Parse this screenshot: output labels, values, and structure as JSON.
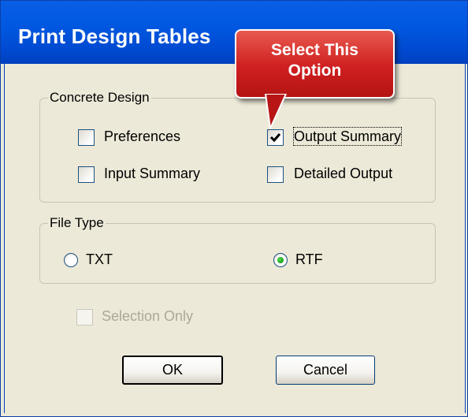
{
  "window": {
    "title": "Print  Design Tables"
  },
  "callout": {
    "line1": "Select This",
    "line2": "Option"
  },
  "concrete_design": {
    "label": "Concrete Design",
    "options": [
      {
        "label": "Preferences",
        "checked": false
      },
      {
        "label": "Output Summary",
        "checked": true
      },
      {
        "label": "Input Summary",
        "checked": false
      },
      {
        "label": "Detailed Output",
        "checked": false
      }
    ]
  },
  "file_type": {
    "label": "File Type",
    "options": [
      {
        "label": "TXT",
        "selected": false
      },
      {
        "label": "RTF",
        "selected": true
      }
    ]
  },
  "selection_only": {
    "label": "Selection Only",
    "checked": false,
    "enabled": false
  },
  "buttons": {
    "ok_label": "OK",
    "cancel_label": "Cancel"
  },
  "colors": {
    "title_bar": "#0058e0",
    "dialog_bg": "#ece9d8",
    "callout_red": "#cf1f1f",
    "radio_green": "#21a121"
  }
}
